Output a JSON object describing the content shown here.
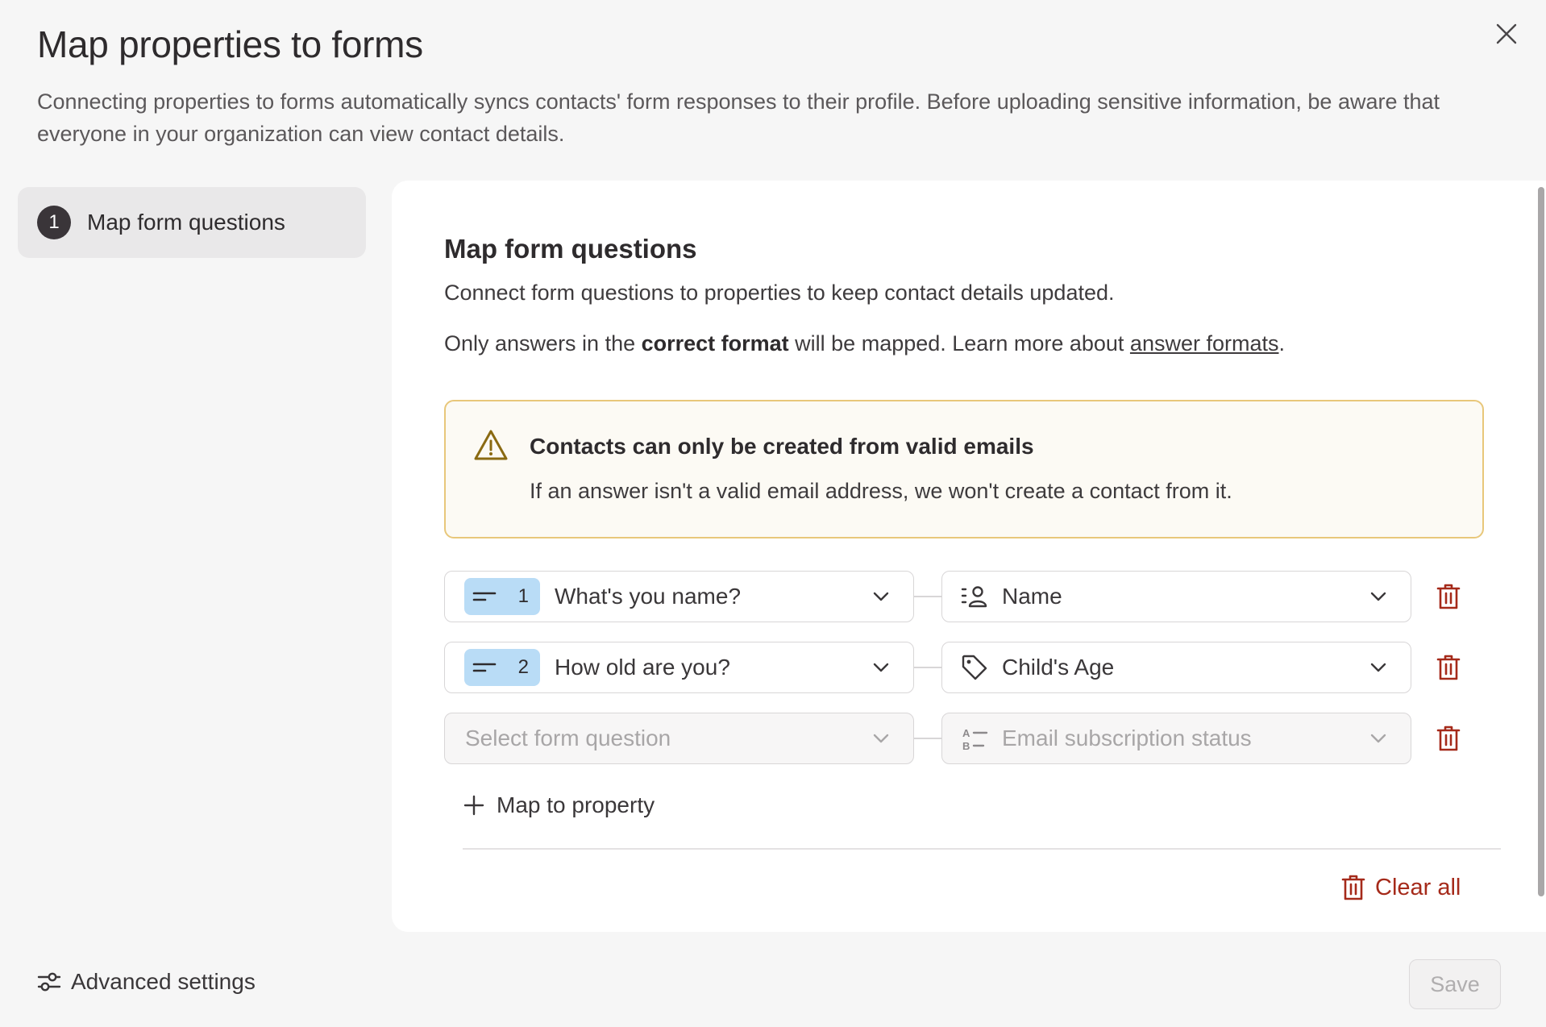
{
  "dialog": {
    "title": "Map properties to forms",
    "description": "Connecting properties to forms automatically syncs contacts' form responses to their profile. Before uploading sensitive information, be aware that everyone in your organization can view contact details."
  },
  "steps": [
    {
      "number": "1",
      "label": "Map form questions",
      "active": true
    }
  ],
  "section": {
    "title": "Map form questions",
    "description": "Connect form questions to properties to keep contact details updated.",
    "note_prefix": "Only answers in the ",
    "note_bold": "correct format",
    "note_middle": " will be mapped. Learn more about ",
    "note_link": "answer formats",
    "note_suffix": "."
  },
  "alert": {
    "icon": "warning-icon",
    "title": "Contacts can only be created from valid emails",
    "text": "If an answer isn't a valid email address, we won't create a contact from it."
  },
  "mappings": [
    {
      "question_number": "1",
      "question": "What's you name?",
      "question_icon": "short-text-icon",
      "property": "Name",
      "property_icon": "person-list-icon"
    },
    {
      "question_number": "2",
      "question": "How old are you?",
      "question_icon": "short-text-icon",
      "property": "Child's Age",
      "property_icon": "tag-icon"
    },
    {
      "question_placeholder": "Select form question",
      "property": "Email subscription status",
      "property_icon": "ab-list-icon"
    }
  ],
  "actions": {
    "add_mapping": "Map to property",
    "clear_all": "Clear all",
    "advanced_settings": "Advanced settings",
    "save": "Save"
  },
  "colors": {
    "danger": "#a52a1a",
    "badge": "#b9dcf6",
    "alert_border": "#e8c77a",
    "alert_icon": "#8a6a12"
  }
}
